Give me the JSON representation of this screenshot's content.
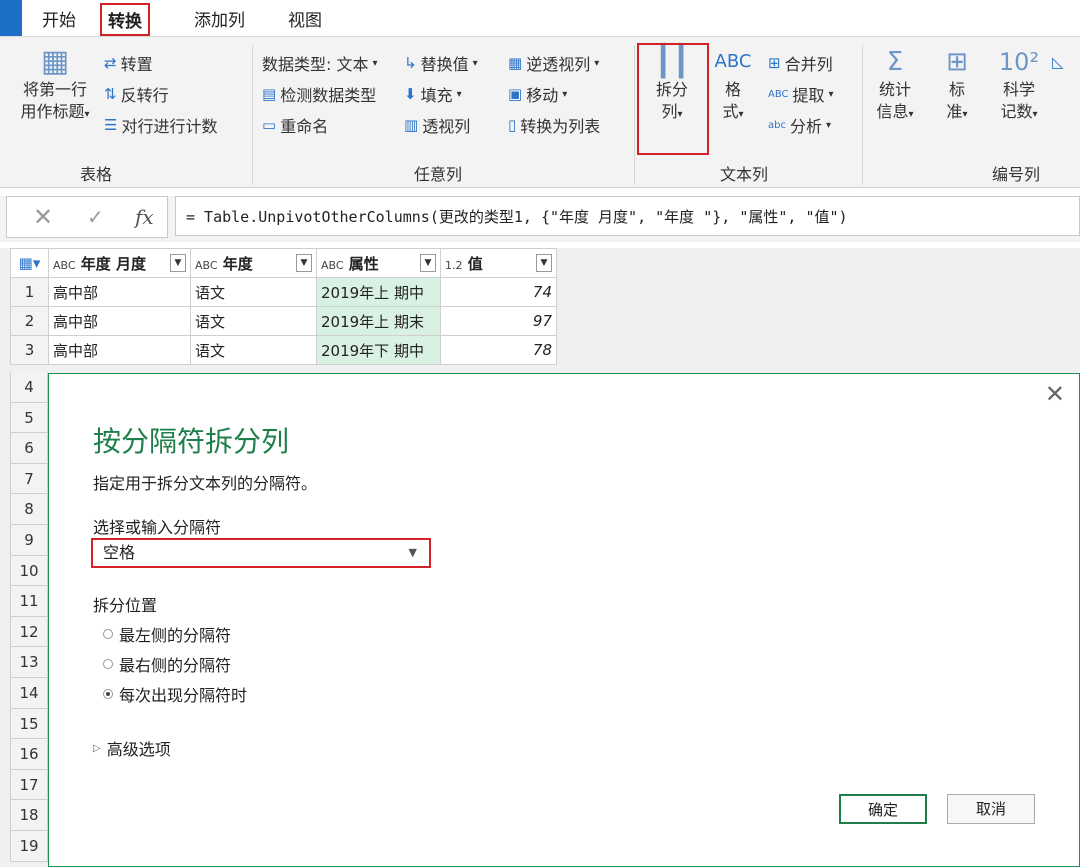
{
  "tabs": [
    "开始",
    "转换",
    "添加列",
    "视图"
  ],
  "ribbon": {
    "table_group": {
      "label": "表格",
      "use_first_row": [
        "将第一行",
        "用作标题"
      ],
      "transpose": "转置",
      "reverse_rows": "反转行",
      "count_rows": "对行进行计数"
    },
    "any_column": {
      "label": "任意列",
      "data_type": "数据类型: 文本",
      "detect_type": "检测数据类型",
      "rename": "重命名",
      "replace_values": "替换值",
      "fill": "填充",
      "pivot": "透视列",
      "unpivot": "逆透视列",
      "move": "移动",
      "to_list": "转换为列表"
    },
    "text_column": {
      "label": "文本列",
      "split": [
        "拆分",
        "列"
      ],
      "format": [
        "格",
        "式"
      ],
      "merge": "合并列",
      "extract": "提取",
      "parse": "分析"
    },
    "number_column": {
      "label": "编号列",
      "statistics": [
        "统计",
        "信息"
      ],
      "standard": [
        "标",
        "准"
      ],
      "scientific": [
        "科学",
        "记数"
      ]
    }
  },
  "formula": {
    "text": "= Table.UnpivotOtherColumns(更改的类型1, {\"年度 月度\", \"年度 \"}, \"属性\", \"值\")"
  },
  "table": {
    "columns": [
      {
        "type": "ABC",
        "name": "年度 月度"
      },
      {
        "type": "ABC",
        "name": "年度"
      },
      {
        "type": "ABC",
        "name": "属性"
      },
      {
        "type": "1.2",
        "name": "值"
      }
    ],
    "rows": [
      {
        "n": "1",
        "c1": "高中部",
        "c2": "语文",
        "c3": "2019年上 期中",
        "c4": "74"
      },
      {
        "n": "2",
        "c1": "高中部",
        "c2": "语文",
        "c3": "2019年上 期末",
        "c4": "97"
      },
      {
        "n": "3",
        "c1": "高中部",
        "c2": "语文",
        "c3": "2019年下 期中",
        "c4": "78"
      }
    ],
    "extra_row_numbers": [
      "4",
      "5",
      "6",
      "7",
      "8",
      "9",
      "10",
      "11",
      "12",
      "13",
      "14",
      "15",
      "16",
      "17",
      "18",
      "19"
    ]
  },
  "dialog": {
    "title": "按分隔符拆分列",
    "description": "指定用于拆分文本列的分隔符。",
    "delimiter_label": "选择或输入分隔符",
    "delimiter_value": "空格",
    "split_at_label": "拆分位置",
    "options": [
      "最左侧的分隔符",
      "最右侧的分隔符",
      "每次出现分隔符时"
    ],
    "selected_option": 2,
    "advanced": "高级选项",
    "ok": "确定",
    "cancel": "取消"
  }
}
